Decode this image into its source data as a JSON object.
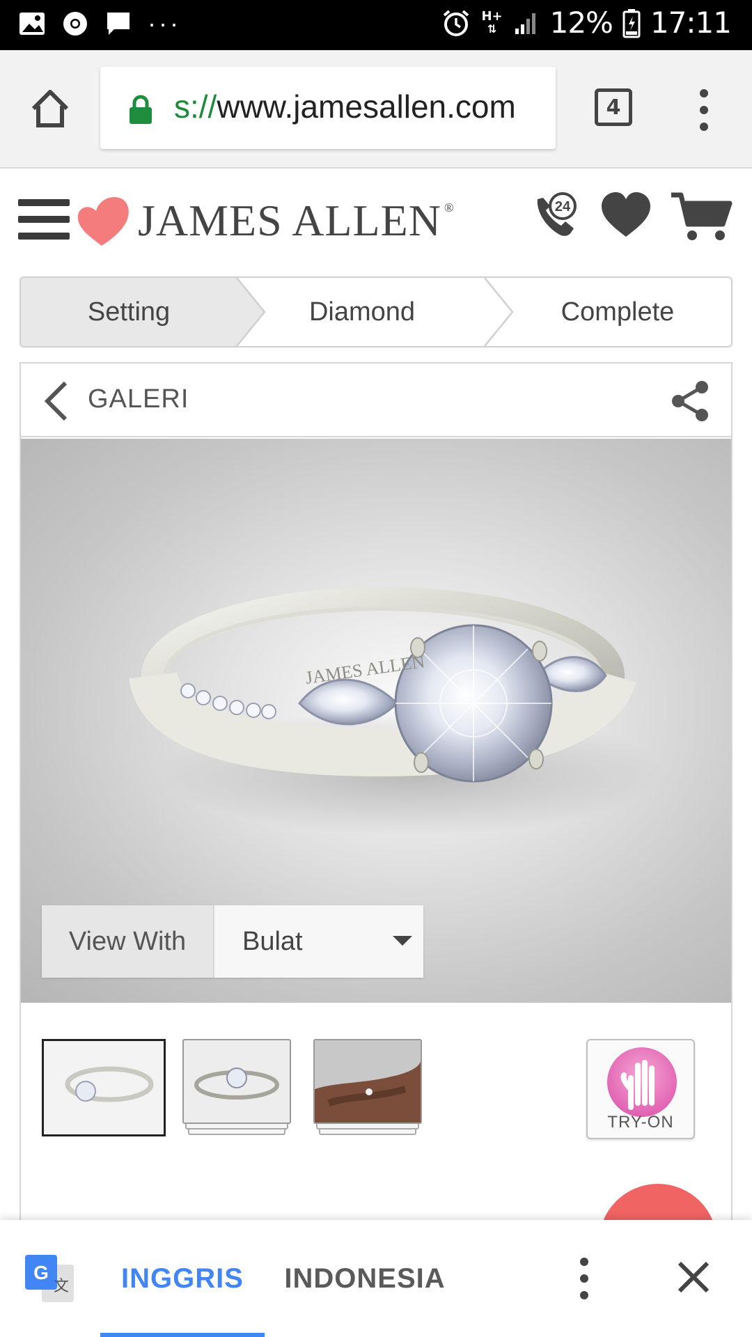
{
  "status_bar": {
    "network": "H+",
    "battery": "12%",
    "time": "17:11",
    "icons": [
      "gallery-icon",
      "chrome-icon",
      "message-icon",
      "more-icon",
      "alarm-icon",
      "signal-icon",
      "battery-icon"
    ]
  },
  "browser": {
    "url_scheme": "s://",
    "url_host": "www.jamesallen.com",
    "tab_count": "4"
  },
  "site": {
    "brand": "JAMES ALLEN",
    "brand_mark": "®",
    "support_badge": "24",
    "brand_color": "#f47c7c"
  },
  "steps": [
    {
      "label": "Setting",
      "active": true
    },
    {
      "label": "Diamond",
      "active": false
    },
    {
      "label": "Complete",
      "active": false
    }
  ],
  "gallery": {
    "back_label": "GALERI",
    "view_with_label": "View With",
    "view_with_value": "Bulat",
    "engraving": "JAMES ALLEN",
    "try_on_label": "TRY-ON"
  },
  "translate_bar": {
    "source_lang": "INGGRIS",
    "target_lang": "INDONESIA",
    "active_color": "#4285f4"
  }
}
